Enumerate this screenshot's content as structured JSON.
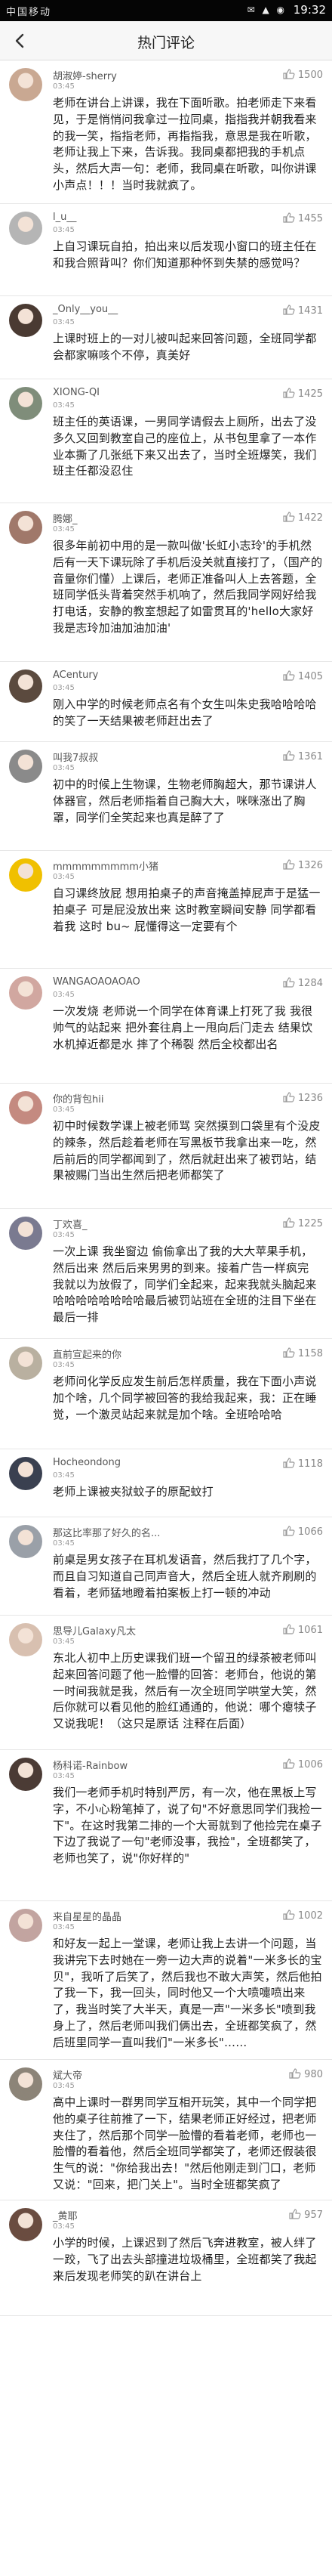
{
  "status_bar": {
    "carrier": "中国移动",
    "time": "19:32",
    "icons": "✉ ▲ ◉"
  },
  "header": {
    "title": "热门评论",
    "back_icon": "back-arrow-icon"
  },
  "comments": [
    {
      "user": "胡淑婷-sherry",
      "time": "03:45",
      "likes": "1500",
      "avatar_color": "#c9a892",
      "text": "老师在讲台上讲课，我在下面听歌。拍老师走下来看见，于是悄悄问我拿过一拉同桌，指指我并朝我看来的我一笑，指指老师，再指指我，意思是我在听歌，老师让我上下来，告诉我。我同桌都把我的手机点头，然后大声一句：老师，我同桌在听歌，叫你讲课小声点！！！当时我就疯了。"
    },
    {
      "user": "l_u__",
      "time": "03:45",
      "likes": "1455",
      "avatar_color": "#b5b5b5",
      "text": "上自习课玩自拍，拍出来以后发现小窗口的班主任在和我合照背叫？你们知道那种怀到失禁的感觉吗？"
    },
    {
      "user": "_Only__you__",
      "time": "03:45",
      "likes": "1431",
      "avatar_color": "#4a3a32",
      "text": "上课时班上的一对儿被叫起来回答问题，全班同学都会都家嘛咳个不停，真美好"
    },
    {
      "user": "XIONG-QI",
      "time": "03:45",
      "likes": "1425",
      "avatar_color": "#7f8d7a",
      "text": "班主任的英语课，一男同学请假去上厕所，出去了没多久又回到教室自己的座位上，从书包里拿了一本作业本撕了几张纸下来又出去了，当时全班爆笑，我们班主任都没忍住"
    },
    {
      "user": "腾娜_",
      "time": "03:45",
      "likes": "1422",
      "avatar_color": "#a0786a",
      "text": "很多年前初中用的是一款叫做'长虹小志玲'的手机然后有一天下课玩除了手机后没关就直接打了，（国产的音量你们懂）上课后，老师正准备叫人上去答题，全班同学低头背着突然手机响了，然后我同学网好给我打电话，安静的教室想起了如雷贯耳的'hello大家好我是志玲加油加油加油'"
    },
    {
      "user": "ACentury",
      "time": "03:45",
      "likes": "1405",
      "avatar_color": "#5b4a3e",
      "text": "刚入中学的时候老师点名有个女生叫朱史我哈哈哈哈的笑了一天结果被老师赶出去了"
    },
    {
      "user": "叫我7叔叔",
      "time": "03:45",
      "likes": "1361",
      "avatar_color": "#8a8a8a",
      "text": "初中的时候上生物课，生物老师胸超大，那节课讲人体器官，然后老师指着自己胸大大，咪咪涨出了胸罩，同学们全笑起来也真是醉了了"
    },
    {
      "user": "mmmmmmmmm小猪",
      "time": "03:45",
      "likes": "1326",
      "avatar_color": "#f0c000",
      "text": "自习课终放屁 想用拍桌子的声音掩盖掉屁声于是猛一拍桌子 可是屁没放出来 这时教室瞬间安静 同学都看着我 这时 bu~ 屁懂得这一定要有个"
    },
    {
      "user": "WANGAOAOAOAO",
      "time": "03:45",
      "likes": "1284",
      "avatar_color": "#d1a7a0",
      "text": "一次发烧 老师说一个同学在体育课上打死了我 我很帅气的站起来 把外套往肩上一甩向后门走去 结果饮水机掉近都是水 摔了个稀裂 然后全校都出名"
    },
    {
      "user": "你的背包hii",
      "time": "03:45",
      "likes": "1236",
      "avatar_color": "#c48a80",
      "text": "初中时候数学课上被老师骂 突然摸到口袋里有个没皮的辣条，然后趁着老师在写黑板节我拿出来一吃，然后前后的同学都闻到了，然后就赶出来了被罚站，结果被赐门当出生然后把老师都笑了"
    },
    {
      "user": "丁欢喜_",
      "time": "03:45",
      "likes": "1225",
      "avatar_color": "#7a7a90",
      "text": "一次上课 我坐窗边 偷偷拿出了我的大大苹果手机，然后出来 然后后来男男的到来。接着广告一样疯完 我就以为放假了，同学们全起来，起来我就头脑起来哈哈哈哈哈哈哈哈最后被罚站班在全班的注目下坐在最后一排"
    },
    {
      "user": "直前宣起来的你",
      "time": "03:45",
      "likes": "1158",
      "avatar_color": "#b9b0a0",
      "text": "老师问化学反应发生前后怎样质量，我在下面小声说加个啥，几个同学被回答的我给我起来，我：正在睡觉，一个激灵站起来就是加个啥。全班哈哈哈"
    },
    {
      "user": "Hocheondong",
      "time": "03:45",
      "likes": "1118",
      "avatar_color": "#3a4050",
      "text": "老师上课被夹狱蚊子的原配蚊打"
    },
    {
      "user": "那这比率那了好久的名...",
      "time": "03:45",
      "likes": "1066",
      "avatar_color": "#9aa0a8",
      "text": "前桌是男女孩子在耳机发语音，然后我打了几个字，而且自习知道自己同声音大，然后全班人就齐刷刷的看着，老师猛地瞪着拍案板上打一顿的冲动"
    },
    {
      "user": "思导儿Galaxy凡太",
      "time": "03:45",
      "likes": "1061",
      "avatar_color": "#d8c0b0",
      "text": "东北人初中上历史课我们班一个留丑的绿茶被老师叫起来回答问题了他一脸懵的回答：老师台，他说的第一时间我就是我，然后有一次全班同学哄堂大笑，然后你就可以看见他的脸红通通的，他说：哪个瘪犊子又说我呢！（这只是原话 注释在后面）"
    },
    {
      "user": "杨科诺-Rainbow",
      "time": "03:45",
      "likes": "1006",
      "avatar_color": "#4b3b35",
      "text": "我们一老师手机时特别严厉，有一次，他在黑板上写字，不小心粉笔掉了，说了句\"不好意思同学们我捡一下\"。在这时我第二排的一个大哥就到了他捡完在桌子下边了我说了一句\"老师没事，我捡\"，全班都笑了，老师也笑了，说\"你好样的\""
    },
    {
      "user": "来自星星的晶晶",
      "time": "03:45",
      "likes": "1002",
      "avatar_color": "#c2a4a0",
      "text": "和好友一起上一堂课，老师让我上去讲一个问题，当我讲完下去时她在一旁一边大声的说着\"一米多长的宝贝\"，我听了后笑了，然后我也不敢大声笑，然后他拍了我一下，我一回头，同时他又一个大喷嚏喷出来了，我当时笑了大半天，真是一声\"一米多长\"喷到我身上了，然后老师叫我们俩出去，全班都笑疯了，然后班里同学一直叫我们\"一米多长\"……"
    },
    {
      "user": "斌大帝",
      "time": "03:45",
      "likes": "980",
      "avatar_color": "#8c8478",
      "text": "高中上课时一群男同学互相开玩笑，其中一个同学把他的桌子往前推了一下，结果老师正好经过，把老师夹住了，然后那个同学一脸懵的看着老师，老师也一脸懵的看着他，然后全班同学都笑了，老师还假装很生气的说：\"你给我出去！\"然后他刚走到门口，老师又说：\"回来，把门关上\"。当时全班都笑疯了"
    },
    {
      "user": "_黄耶",
      "time": "03:45",
      "likes": "957",
      "avatar_color": "#6a4c40",
      "text": "小学的时候，上课迟到了然后飞奔进教室，被人绊了一跤，飞了出去头部撞进垃圾桶里，全班都笑了我起来后发现老师笑的趴在讲台上"
    }
  ]
}
